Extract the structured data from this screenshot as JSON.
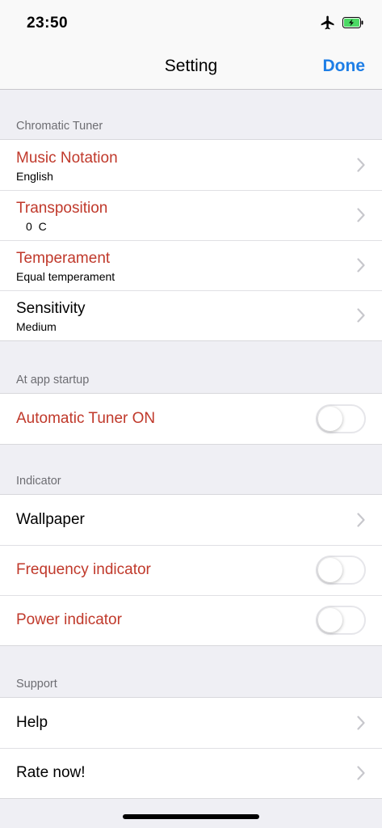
{
  "status_bar": {
    "time": "23:50",
    "icons": [
      "airplane-icon",
      "battery-charging-icon"
    ],
    "battery_color": "#4cd964"
  },
  "nav": {
    "title": "Setting",
    "done_label": "Done",
    "accent": "#1e7ee6"
  },
  "sections": {
    "chromatic": {
      "header": "Chromatic Tuner",
      "music_notation": {
        "label": "Music Notation",
        "value": "English"
      },
      "transposition": {
        "label": "Transposition",
        "value": "0  C"
      },
      "temperament": {
        "label": "Temperament",
        "value": "Equal temperament"
      },
      "sensitivity": {
        "label": "Sensitivity",
        "value": "Medium"
      }
    },
    "startup": {
      "header": "At app startup",
      "auto_tuner": {
        "label": "Automatic Tuner ON",
        "on": false
      }
    },
    "indicator": {
      "header": "Indicator",
      "wallpaper": {
        "label": "Wallpaper"
      },
      "frequency": {
        "label": "Frequency indicator",
        "on": false
      },
      "power": {
        "label": "Power indicator",
        "on": false
      }
    },
    "support": {
      "header": "Support",
      "help": {
        "label": "Help"
      },
      "rate": {
        "label": "Rate now!"
      }
    }
  },
  "colors": {
    "highlight_label": "#c0392b",
    "background": "#efeff4"
  }
}
